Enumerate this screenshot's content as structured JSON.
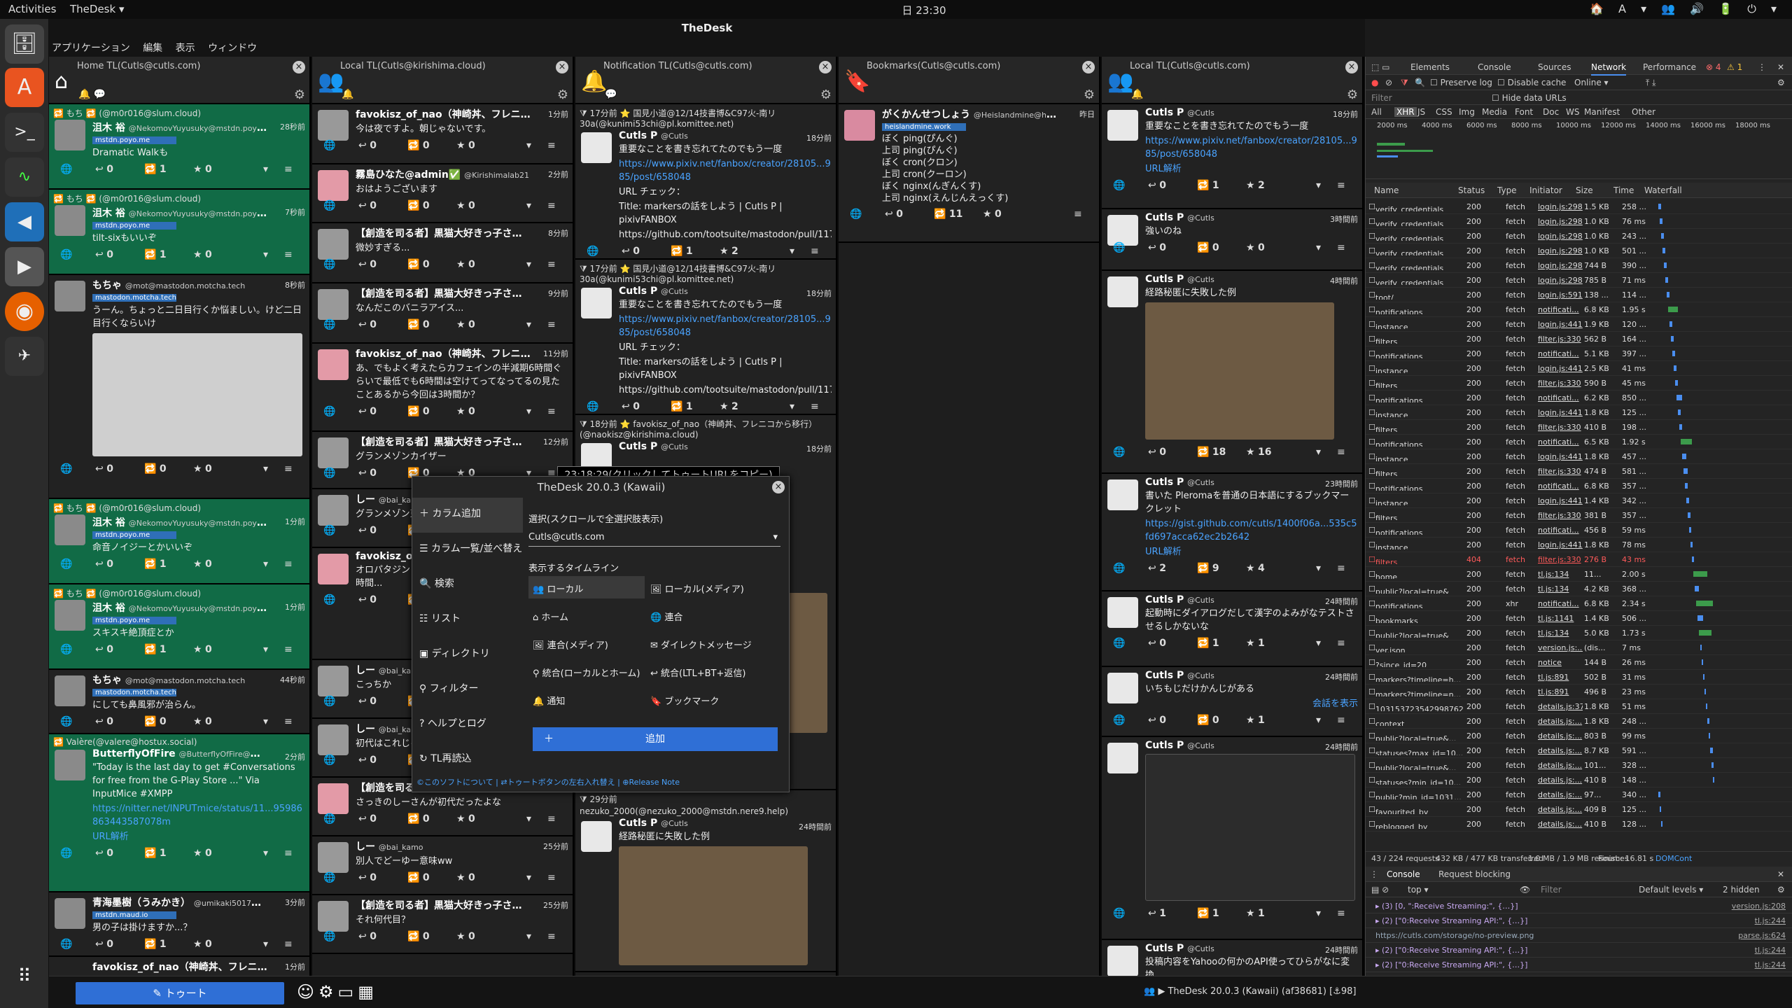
{
  "topbar": {
    "activities": "Activities",
    "app": "TheDesk ▾",
    "clock": "日 23:30",
    "tray": "🏠 A ▾ 👥 🔊 🔋 ⏻ ▾"
  },
  "window": {
    "title": "TheDesk"
  },
  "menubar": [
    "アプリケーション",
    "編集",
    "表示",
    "ウィンドウ"
  ],
  "columns": [
    {
      "title": "Home TL(Cutls@cutls.com)",
      "icon": "home-icon"
    },
    {
      "title": "Local TL(Cutls@kirishima.cloud)",
      "icon": "users-icon"
    },
    {
      "title": "Notification TL(Cutls@cutls.com)",
      "icon": "bell-icon"
    },
    {
      "title": "Bookmarks(Cutls@cutls.com)",
      "icon": "bookmark-icon"
    },
    {
      "title": "Local TL(Cutls@cutls.com)",
      "icon": "users-icon"
    }
  ],
  "col1": [
    {
      "boost": "もち 🔁 (@m0r016@slum.cloud)",
      "name": "沮木 裕",
      "acct": "@NekomovYuyusuky@mstdn.poyo.me",
      "time": "28秒前",
      "inst": "mstdn.poyo.me",
      "body": "Dramatic Walkも",
      "rb": "0",
      "fav": "0",
      "bt": "1"
    },
    {
      "boost": "もち 🔁 (@m0r016@slum.cloud)",
      "name": "沮木 裕",
      "acct": "@NekomovYuyusuky@mstdn.poyo.me",
      "time": "7秒前",
      "inst": "mstdn.poyo.me",
      "body": "tilt-sixもいいぞ",
      "rb": "0",
      "fav": "0",
      "bt": "1"
    },
    {
      "boost": "",
      "name": "もちゃ",
      "acct": "@mot@mastodon.motcha.tech",
      "time": "8秒前",
      "inst": "mastodon.motcha.tech",
      "body": "うーん。ちょっと二日目行くか悩ましい。けど二日目行くならいけ",
      "rb": "0",
      "fav": "0",
      "bt": "0"
    },
    {
      "boost": "もち 🔁 (@m0r016@slum.cloud)",
      "name": "沮木 裕",
      "acct": "@NekomovYuyusuky@mstdn.poyo.me",
      "time": "1分前",
      "inst": "mstdn.poyo.me",
      "body": "命音ノイジーとかいいぞ",
      "rb": "0",
      "fav": "0",
      "bt": "1"
    },
    {
      "boost": "もち 🔁 (@m0r016@slum.cloud)",
      "name": "沮木 裕",
      "acct": "@NekomovYuyusuky@mstdn.poyo.me",
      "time": "1分前",
      "inst": "mstdn.poyo.me",
      "body": "スキスキ絶頂症とか",
      "rb": "0",
      "fav": "0",
      "bt": "1"
    },
    {
      "boost": "",
      "name": "もちゃ",
      "acct": "@mot@mastodon.motcha.tech",
      "time": "44秒前",
      "inst": "mastodon.motcha.tech",
      "body": "にしても鼻風邪が治らん。",
      "rb": "0",
      "fav": "0",
      "bt": "0"
    }
  ],
  "col1b": {
    "boost": "Valère(@valere@hostux.social)",
    "name": "ButterflyOfFire",
    "acct": "@ButterflyOfFire@mstdn.fr",
    "time": "2分前",
    "body": "\"Today is the last day to get #Conversations for free from the G-Play Store ...\" Via InputMice #XMPP",
    "link": "https://nitter.net/INPUTmice/status/11...9598686344358707​8m",
    "url": "URL解析"
  },
  "col1c": {
    "name": "青海墨樹（うみかき）",
    "acct": "@umikaki5017@mst...",
    "time": "3分前",
    "inst": "mstdn.maud.io",
    "body": "男の子は掛けますか...？"
  },
  "col1d": {
    "name": "favokisz_of_nao（神崎丼、フレニコ...",
    "time": "1分前"
  },
  "col2": [
    {
      "name": "favokisz_of_nao（神崎丼、フレニコ...",
      "time": "1分前",
      "body": "今は夜ですよ。朝じゃないです。"
    },
    {
      "name": "霧島ひなた@admin✅",
      "acct": "@Kirishimalab21",
      "time": "2分前",
      "body": "おはようございます"
    },
    {
      "name": "【創造を司る者】黒猫大好きっ子さん...",
      "time": "8分前",
      "body": "微妙すぎる..."
    },
    {
      "name": "【創造を司る者】黒猫大好きっ子さん...",
      "time": "9分前",
      "body": "なんだこのバニラアイス..."
    },
    {
      "name": "favokisz_of_nao（神崎丼、フレニコ...",
      "time": "11分前",
      "body": "あ、でもよく考えたらカフェインの半減期6時間ぐらいで最低でも6時間は空けてってなってるの見たことあるから今回は3時間か？"
    },
    {
      "name": "【創造を司る者】黒猫大好きっ子さん...",
      "time": "12分前",
      "body": "グランメゾンカイザー"
    },
    {
      "name": "しー",
      "acct": "@bai_kamo",
      "time": "",
      "body": "グランメゾン東京"
    },
    {
      "name": "favokisz_of_n...",
      "time": "",
      "body": "オロパタジン ええ？ 1日2回っぽいけど だから、6時間..."
    },
    {
      "name": "しー",
      "acct": "@bai_kamo",
      "time": "",
      "body": "こっちか"
    },
    {
      "name": "しー",
      "acct": "@bai_kamo",
      "time": "",
      "body": "初代はこれじゃ..."
    },
    {
      "name": "【創造を司る者】黒猫大好きっ子さん...",
      "time": "25分前",
      "body": "さっきのしーさんが初代だったよな"
    },
    {
      "name": "しー",
      "acct": "@bai_kamo",
      "time": "25分前",
      "body": "別人でどーゆー意味ww"
    },
    {
      "name": "【創造を司る者】黒猫大好きっ子さん...",
      "time": "25分前",
      "body": "それ何代目？"
    }
  ],
  "col3": [
    {
      "notif": "17分前 ⭐ 国見小道@12/14技書博&C97火-南リ30a(@kunimi53chi@pl.komittee.net)",
      "name": "Cutls P",
      "acct": "@Cutls",
      "time": "18分前",
      "body": "重要なことを書き忘れてたのでもう一度",
      "link": "https://www.pixiv.net/fanbox/creator/28105...985/post/658048",
      "check": "URL チェック：",
      "ctitle": "Title: markersの話をしよう | Cutls P | pixivFANBOX",
      "clink": "https://github.com/tootsuite/mastodon/pull/11762 ...",
      "bt": "1",
      "fav": "2"
    },
    {
      "notif": "17分前 ⭐ 国見小道@12/14技書博&C97火-南リ30a(@kunimi53chi@pl.komittee.net)",
      "name": "Cutls P",
      "acct": "@Cutls",
      "time": "18分前",
      "body": "重要なことを書き忘れてたのでもう一度",
      "link": "https://www.pixiv.net/fanbox/creator/28105...985/post/658048",
      "check": "URL チェック：",
      "ctitle": "Title: markersの話をしよう | Cutls P | pixivFANBOX",
      "clink": "https://github.com/tootsuite/mastodon/pull/11762 ...",
      "bt": "1",
      "fav": "2"
    }
  ],
  "col3c": {
    "notif": "18分前 ⭐ favokisz_of_nao（神崎丼、フレニコから移行）(@naokisz@kirishima.cloud)",
    "name": "Cutls P",
    "acct": "@Cutls",
    "time": "18分前"
  },
  "col3d": {
    "notif": "29分前",
    "acct": "nezuko_2000(@nezuko_2000@mstdn.nere9.help)",
    "name": "Cutls P",
    "aa": "@Cutls",
    "time": "24時間前",
    "body": "経路秘匿に失敗した例"
  },
  "col4": {
    "name": "がくかんせつしょう",
    "acct": "@Heislandmine@heisla...",
    "time": "昨日",
    "inst": "heislandmine.work",
    "lines": [
      "ぼく ping(ぴんぐ)",
      "上司 ping(ぴんぐ)",
      "ぼく cron(クロン)",
      "上司 cron(クーロン)",
      "ぼく nginx(んぎんくす)",
      "上司 nginx(えんじんえっくす)"
    ],
    "rb": "0",
    "bt": "11",
    "fav": "0"
  },
  "col5": [
    {
      "name": "Cutls P",
      "acct": "@Cutls",
      "time": "18分前",
      "body": "重要なことを書き忘れてたのでもう一度",
      "link": "https://www.pixiv.net/fanbox/creator/28105...985/post/658048",
      "url": "URL解析",
      "rb": "0",
      "bt": "1",
      "fav": "2"
    },
    {
      "name": "Cutls P",
      "acct": "@Cutls",
      "time": "3時間前",
      "body": "強いのね",
      "rb": "0",
      "bt": "0",
      "fav": "0"
    },
    {
      "name": "Cutls P",
      "acct": "@Cutls",
      "time": "4時間前",
      "body": "経路秘匿に失敗した例",
      "rb": "0",
      "bt": "18",
      "fav": "16"
    },
    {
      "name": "Cutls P",
      "acct": "@Cutls",
      "time": "23時間前",
      "body": "書いた Pleromaを普通の日本語にするブックマークレット",
      "link": "https://gist.github.com/cutls/1400f06a...535c5fd697acca62ec2b2642",
      "url": "URL解析",
      "rb": "2",
      "bt": "9",
      "fav": "4"
    },
    {
      "name": "Cutls P",
      "acct": "@Cutls",
      "time": "24時間前",
      "body": "起動時にダイアログだして漢字のよみがなテストさせるしかないな",
      "rb": "0",
      "bt": "1",
      "fav": "1"
    },
    {
      "name": "Cutls P",
      "acct": "@Cutls",
      "time": "24時間前",
      "body": "いちもじだけかんじがある",
      "extra": "会話を表示",
      "rb": "0",
      "bt": "0",
      "fav": "1"
    },
    {
      "name": "Cutls P",
      "acct": "@Cutls",
      "time": "24時間前",
      "body": "",
      "rb": "1",
      "bt": "1",
      "fav": "1"
    },
    {
      "name": "Cutls P",
      "acct": "@Cutls",
      "time": "24時間前",
      "body": "投稿内容をYahooの何かのAPI使ってひらがなに変換...",
      "rb": "",
      "bt": "",
      "fav": ""
    }
  ],
  "tooltip": "23:18:29(クリックしてトゥートURLをコピー)",
  "menu": {
    "title": "TheDesk 20.0.3 (Kawaii)",
    "left": [
      "カラム追加",
      "カラム一覧/並べ替え",
      "検索",
      "リスト",
      "ディレクトリ",
      "フィルター",
      "ヘルプとログ",
      "TL再読込"
    ],
    "select_label": "選択(スクロールで全選択肢表示)",
    "account": "Cutls@cutls.com",
    "tl_label": "表示するタイムライン",
    "options": [
      "ローカル",
      "ローカル(メディア)",
      "ホーム",
      "連合",
      "連合(メディア)",
      "ダイレクトメッセージ",
      "統合(ローカルとホーム)",
      "統合(LTL+BT+返信)",
      "通知",
      "ブックマーク"
    ],
    "add": "追加",
    "footer": "©このソフトについて | ⇄トゥートボタンの左右入れ替え | ⊕Release Note"
  },
  "bottom": {
    "toot": "トゥート",
    "version": "TheDesk 20.0.3 (Kawaii) (af38681) [⚓98]"
  },
  "devtools": {
    "tabs": [
      "Elements",
      "Console",
      "Sources",
      "Network",
      "Performance"
    ],
    "errors": "4",
    "warnings": "1",
    "preserve": "Preserve log",
    "disable_cache": "Disable cache",
    "online": "Online",
    "filter": "Filter",
    "hide_urls": "Hide data URLs",
    "types": [
      "All",
      "XHR",
      "JS",
      "CSS",
      "Img",
      "Media",
      "Font",
      "Doc",
      "WS",
      "Manifest",
      "Other"
    ],
    "ticks": [
      "2000 ms",
      "4000 ms",
      "6000 ms",
      "8000 ms",
      "10000 ms",
      "12000 ms",
      "14000 ms",
      "16000 ms",
      "18000 ms"
    ],
    "headers": [
      "Name",
      "Status",
      "Type",
      "Initiator",
      "Size",
      "Time",
      "Waterfall"
    ],
    "rows": [
      [
        "verify_credentials",
        "200",
        "fetch",
        "login.js:298",
        "1.5 KB",
        "258 ..."
      ],
      [
        "verify_credentials",
        "200",
        "fetch",
        "login.js:298",
        "1.0 KB",
        "76 ms"
      ],
      [
        "verify_credentials",
        "200",
        "fetch",
        "login.js:298",
        "1.0 KB",
        "243 ..."
      ],
      [
        "verify_credentials",
        "200",
        "fetch",
        "login.js:298",
        "1.0 KB",
        "501 ..."
      ],
      [
        "verify_credentials",
        "200",
        "fetch",
        "login.js:298",
        "744 B",
        "390 ..."
      ],
      [
        "verify_credentials",
        "200",
        "fetch",
        "login.js:298",
        "785 B",
        "71 ms"
      ],
      [
        "toot/",
        "200",
        "fetch",
        "login.js:591",
        "138 ...",
        "114 ..."
      ],
      [
        "notifications",
        "200",
        "fetch",
        "notificati...",
        "6.8 KB",
        "1.95 s"
      ],
      [
        "instance",
        "200",
        "fetch",
        "login.js:441",
        "1.9 KB",
        "120 ..."
      ],
      [
        "filters",
        "200",
        "fetch",
        "filter.js:330",
        "562 B",
        "164 ..."
      ],
      [
        "notifications",
        "200",
        "fetch",
        "notificati...",
        "5.1 KB",
        "397 ..."
      ],
      [
        "instance",
        "200",
        "fetch",
        "login.js:441",
        "2.5 KB",
        "41 ms"
      ],
      [
        "filters",
        "200",
        "fetch",
        "filter.js:330",
        "590 B",
        "45 ms"
      ],
      [
        "notifications",
        "200",
        "fetch",
        "notificati...",
        "6.2 KB",
        "850 ..."
      ],
      [
        "instance",
        "200",
        "fetch",
        "login.js:441",
        "1.8 KB",
        "125 ..."
      ],
      [
        "filters",
        "200",
        "fetch",
        "filter.js:330",
        "410 B",
        "198 ..."
      ],
      [
        "notifications",
        "200",
        "fetch",
        "notificati...",
        "6.5 KB",
        "1.92 s"
      ],
      [
        "instance",
        "200",
        "fetch",
        "login.js:441",
        "1.8 KB",
        "457 ..."
      ],
      [
        "filters",
        "200",
        "fetch",
        "filter.js:330",
        "474 B",
        "581 ..."
      ],
      [
        "notifications",
        "200",
        "fetch",
        "notificati...",
        "6.8 KB",
        "357 ..."
      ],
      [
        "instance",
        "200",
        "fetch",
        "login.js:441",
        "1.4 KB",
        "342 ..."
      ],
      [
        "filters",
        "200",
        "fetch",
        "filter.js:330",
        "381 B",
        "357 ..."
      ],
      [
        "notifications",
        "200",
        "fetch",
        "notificati...",
        "456 B",
        "59 ms"
      ],
      [
        "instance",
        "200",
        "fetch",
        "login.js:441",
        "1.8 KB",
        "78 ms"
      ],
      [
        "filters",
        "404",
        "fetch",
        "filter.js:330",
        "276 B",
        "43 ms"
      ],
      [
        "home",
        "200",
        "fetch",
        "tl.js:134",
        "11...",
        "2.00 s"
      ],
      [
        "public?local=true&",
        "200",
        "fetch",
        "tl.js:134",
        "4.2 KB",
        "368 ..."
      ],
      [
        "notifications",
        "200",
        "xhr",
        "notificati...",
        "6.8 KB",
        "2.34 s"
      ],
      [
        "bookmarks",
        "200",
        "fetch",
        "tl.js:1141",
        "1.4 KB",
        "506 ..."
      ],
      [
        "public?local=true&",
        "200",
        "fetch",
        "tl.js:134",
        "5.0 KB",
        "1.73 s"
      ],
      [
        "ver.json",
        "200",
        "fetch",
        "version.js:...",
        "(dis...",
        "7 ms"
      ],
      [
        "?since_id=20",
        "200",
        "fetch",
        "notice",
        "144 B",
        "26 ms"
      ],
      [
        "markers?timeline=h...",
        "200",
        "fetch",
        "tl.js:891",
        "502 B",
        "31 ms"
      ],
      [
        "markers?timeline=n...",
        "200",
        "fetch",
        "tl.js:891",
        "496 B",
        "23 ms"
      ],
      [
        "103153723542998762",
        "200",
        "fetch",
        "details.js:37",
        "1.8 KB",
        "51 ms"
      ],
      [
        "context",
        "200",
        "fetch",
        "details.js:...",
        "1.8 KB",
        "248 ..."
      ],
      [
        "public?local=true&...",
        "200",
        "fetch",
        "details.js:...",
        "803 B",
        "99 ms"
      ],
      [
        "statuses?max_id=10...",
        "200",
        "fetch",
        "details.js:...",
        "8.7 KB",
        "591 ..."
      ],
      [
        "public?local=true&...",
        "200",
        "fetch",
        "details.js:...",
        "101...",
        "328 ..."
      ],
      [
        "statuses?min_id=10...",
        "200",
        "fetch",
        "details.js:...",
        "410 B",
        "148 ..."
      ],
      [
        "public?min_id=1031...",
        "200",
        "fetch",
        "details.js:...",
        "97...",
        "340 ..."
      ],
      [
        "favourited_by",
        "200",
        "fetch",
        "details.js:...",
        "409 B",
        "125 ..."
      ],
      [
        "reblogged_by",
        "200",
        "fetch",
        "details.js:...",
        "410 B",
        "128 ..."
      ]
    ],
    "summary": [
      "43 / 224 requests",
      "432 KB / 477 KB transferred",
      "1.0 MB / 1.9 MB resources",
      "Finish: 16.81 s",
      "DOMCont"
    ],
    "console_tabs": [
      "Console",
      "Request blocking"
    ],
    "context": "top",
    "cfilter": "Filter",
    "levels": "Default levels ▾",
    "hidden": "2 hidden",
    "logs": [
      [
        "▸ (3) [0, \":Receive Streaming:\", {…}]",
        "version.js:208"
      ],
      [
        "▸ (2) [\"0:Receive Streaming API:\", {…}]",
        "tl.js:244"
      ],
      [
        "https://cutls.com/storage/no-preview.png",
        "parse.js:624"
      ],
      [
        "▸ (2) [\"0:Receive Streaming API:\", {…}]",
        "tl.js:244"
      ],
      [
        "▸ (2) [\"0:Receive Streaming API:\", {…}]",
        "tl.js:244"
      ]
    ]
  }
}
